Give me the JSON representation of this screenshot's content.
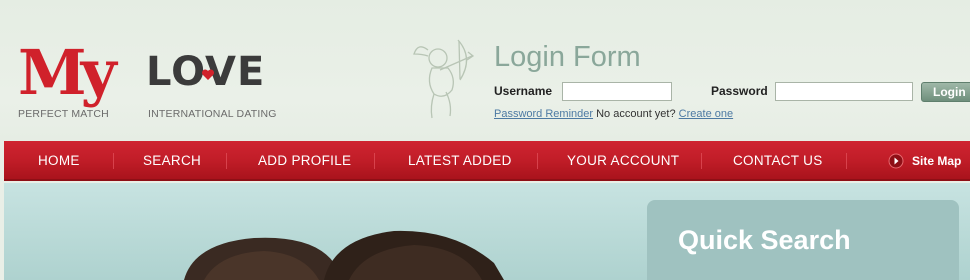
{
  "logo": {
    "my": "My",
    "love": "LOVE",
    "tagline_left": "PERFECT MATCH",
    "tagline_right": "INTERNATIONAL DATING",
    "colors": {
      "my": "#d0212b",
      "love": "#3b3b3b"
    }
  },
  "login": {
    "title": "Login Form",
    "username_label": "Username",
    "password_label": "Password",
    "username_value": "",
    "password_value": "",
    "button_label": "Login",
    "reminder_link": "Password Reminder",
    "no_account_text": "No account yet?",
    "create_link": "Create one"
  },
  "nav": {
    "items": [
      "HOME",
      "SEARCH",
      "ADD PROFILE",
      "LATEST ADDED",
      "YOUR ACCOUNT",
      "CONTACT US"
    ],
    "sitemap_label": "Site Map",
    "color": "#c11d28"
  },
  "quick_search": {
    "title": "Quick Search"
  },
  "icons": [
    "cupid-icon",
    "heart-icon",
    "sitemap-arrow-icon"
  ]
}
